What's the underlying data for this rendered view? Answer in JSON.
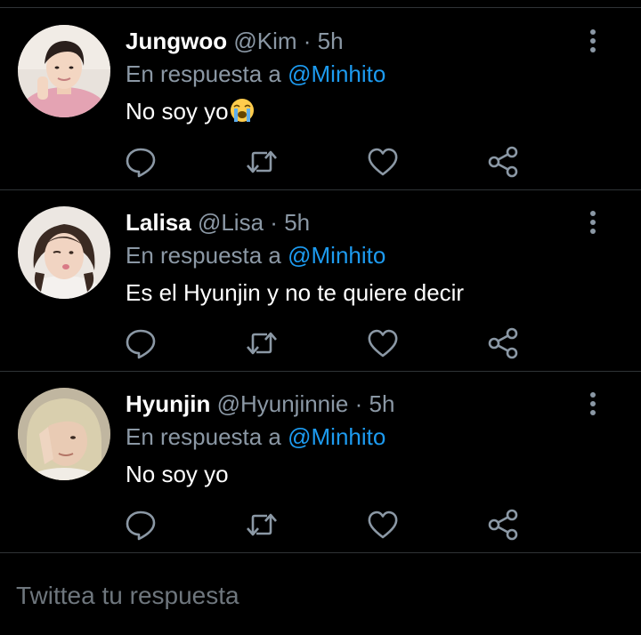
{
  "colors": {
    "background": "#000000",
    "divider": "#2f3336",
    "name": "#ffffff",
    "muted": "#8b98a5",
    "mention": "#1d9bf0",
    "icon": "#8b98a5"
  },
  "tweets": [
    {
      "name": "Jungwoo",
      "handle": "@Kim",
      "separator": "·",
      "time": "5h",
      "reply_prefix": "En respuesta a",
      "reply_to": "@Minhito",
      "text": "No soy yo",
      "emoji": "loudly-crying-face",
      "avatar": "avatar-jungwoo"
    },
    {
      "name": "Lalisa",
      "handle": "@Lisa",
      "separator": "·",
      "time": "5h",
      "reply_prefix": "En respuesta a",
      "reply_to": "@Minhito",
      "text": "Es el Hyunjin y no te quiere decir",
      "avatar": "avatar-lalisa"
    },
    {
      "name": "Hyunjin",
      "handle": "@Hyunjinnie",
      "separator": "·",
      "time": "5h",
      "reply_prefix": "En respuesta a",
      "reply_to": "@Minhito",
      "text": "No soy yo",
      "avatar": "avatar-hyunjin"
    }
  ],
  "actions": [
    "reply-icon",
    "retweet-icon",
    "like-icon",
    "share-icon"
  ],
  "more_icon": "more-vertical-icon",
  "compose": {
    "placeholder": "Twittea tu respuesta"
  }
}
